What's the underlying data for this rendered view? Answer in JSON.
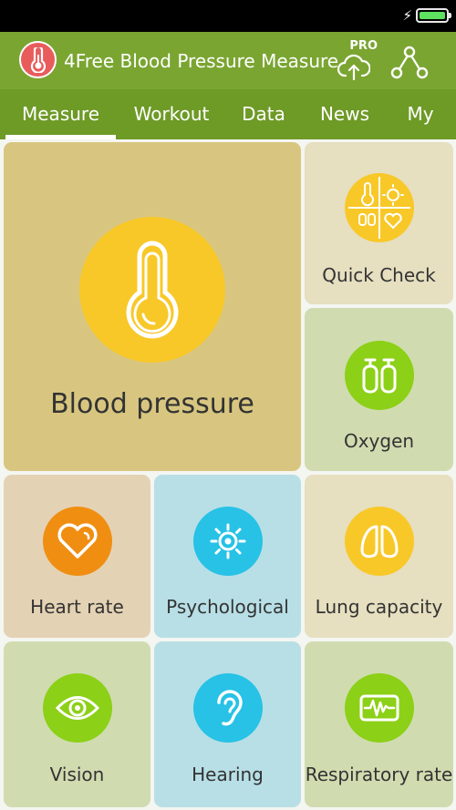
{
  "app": {
    "title": "4Free Blood Pressure Measure",
    "pro_label": "PRO"
  },
  "tabs": [
    {
      "label": "Measure",
      "active": true
    },
    {
      "label": "Workout",
      "active": false
    },
    {
      "label": "Data",
      "active": false
    },
    {
      "label": "News",
      "active": false
    },
    {
      "label": "My",
      "active": false
    }
  ],
  "tiles": {
    "blood_pressure": {
      "label": "Blood pressure",
      "icon": "thermometer-icon"
    },
    "quick_check": {
      "label": "Quick Check",
      "icon": "quick-check-icon"
    },
    "oxygen": {
      "label": "Oxygen",
      "icon": "oxygen-icon"
    },
    "heart_rate": {
      "label": "Heart rate",
      "icon": "heart-icon"
    },
    "psychological": {
      "label": "Psychological",
      "icon": "sun-icon"
    },
    "lung_capacity": {
      "label": "Lung capacity",
      "icon": "lungs-icon"
    },
    "vision": {
      "label": "Vision",
      "icon": "eye-icon"
    },
    "hearing": {
      "label": "Hearing",
      "icon": "ear-icon"
    },
    "respiratory_rate": {
      "label": "Respiratory rate",
      "icon": "waveform-icon"
    }
  },
  "colors": {
    "app_bar": "#7aa531",
    "tab_bar": "#6e9a26",
    "tile_tan": "#d8c680",
    "tile_cream": "#e6dfc0",
    "tile_sage": "#d0dcb0",
    "tile_peach": "#e4d2b4",
    "tile_cyan": "#b8dfe6",
    "circle_yellow": "#f8c828",
    "circle_green": "#8cd017",
    "circle_orange": "#f08e12",
    "circle_blue": "#27c2e6"
  }
}
